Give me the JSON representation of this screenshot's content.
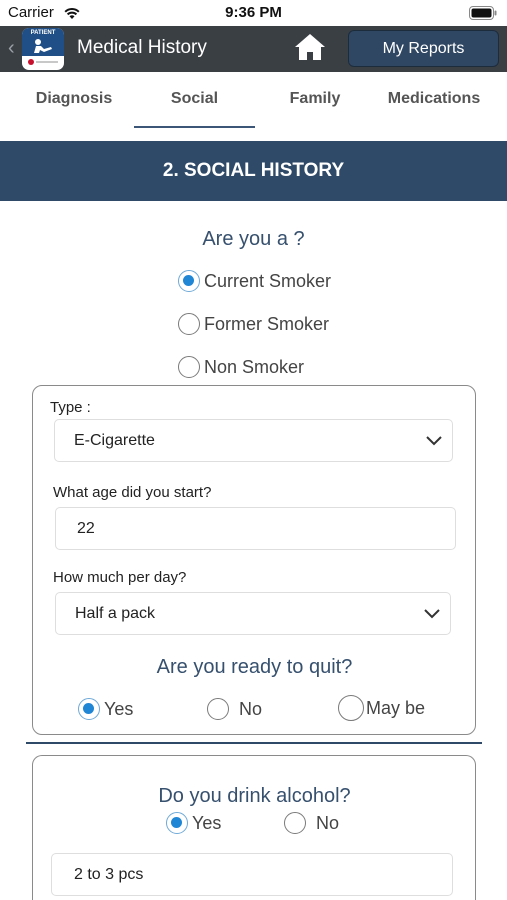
{
  "status_bar": {
    "carrier": "Carrier",
    "time": "9:36 PM"
  },
  "header": {
    "logo_text": "PATIENT",
    "title": "Medical History",
    "my_reports_label": "My Reports"
  },
  "tabs": [
    {
      "label": "Diagnosis",
      "selected": false
    },
    {
      "label": "Social",
      "selected": true
    },
    {
      "label": "Family",
      "selected": false
    },
    {
      "label": "Medications",
      "selected": false
    }
  ],
  "section": {
    "title": "2. SOCIAL HISTORY"
  },
  "smoker": {
    "question": "Are you a ?",
    "options": [
      {
        "label": "Current Smoker",
        "selected": true
      },
      {
        "label": "Former Smoker",
        "selected": false
      },
      {
        "label": "Non Smoker",
        "selected": false
      }
    ]
  },
  "smoking_details": {
    "type_label": "Type :",
    "type_value": "E-Cigarette",
    "age_label": "What age did you start?",
    "age_value": "22",
    "per_day_label": "How much per day?",
    "per_day_value": "Half a pack",
    "quit_question": "Are you ready to quit?",
    "quit_options": [
      {
        "label": "Yes",
        "selected": true
      },
      {
        "label": "No",
        "selected": false
      },
      {
        "label": "May be",
        "selected": false
      }
    ]
  },
  "alcohol": {
    "question": "Do you drink alcohol?",
    "options": [
      {
        "label": "Yes",
        "selected": true
      },
      {
        "label": "No",
        "selected": false
      }
    ],
    "amount_value": "2 to 3 pcs"
  },
  "colors": {
    "banner": "#2e4a68",
    "header_bg": "#3a3f44",
    "radio_selected": "#1f86d6",
    "question_text": "#36506e"
  }
}
